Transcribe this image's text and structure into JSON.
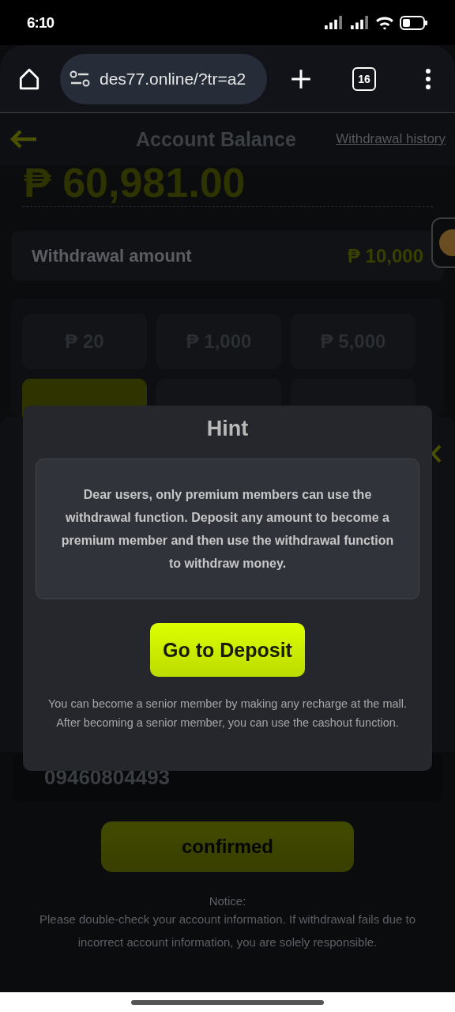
{
  "status_bar": {
    "time": "6:10"
  },
  "browser": {
    "url": "des77.online/?tr=a2",
    "tab_count": "16"
  },
  "header": {
    "title": "Account Balance",
    "link": "Withdrawal history"
  },
  "balance": "₱ 60,981.00",
  "withdrawal_amount": {
    "label": "Withdrawal amount",
    "value": "₱ 10,000"
  },
  "amount_options": [
    {
      "label": "₱ 20",
      "selected": false
    },
    {
      "label": "₱ 1,000",
      "selected": false
    },
    {
      "label": "₱ 5,000",
      "selected": false
    },
    {
      "selected": true
    },
    {
      "selected": false
    },
    {
      "selected": false
    }
  ],
  "account_number": "09460804493",
  "confirm_button": "confirmed",
  "notice": {
    "title": "Notice:",
    "text": "Please double-check your account information. If withdrawal fails due to incorrect account information, you are solely responsible."
  },
  "dialog": {
    "title": "Hint",
    "message": "Dear users, only premium members can use the withdrawal function. Deposit any amount to become a premium member and then use the withdrawal function to withdraw money.",
    "button": "Go to Deposit",
    "footnote_lines": [
      "You can become a senior member by making any recharge at the mall.",
      "After becoming a senior member, you can use the cashout function."
    ]
  }
}
